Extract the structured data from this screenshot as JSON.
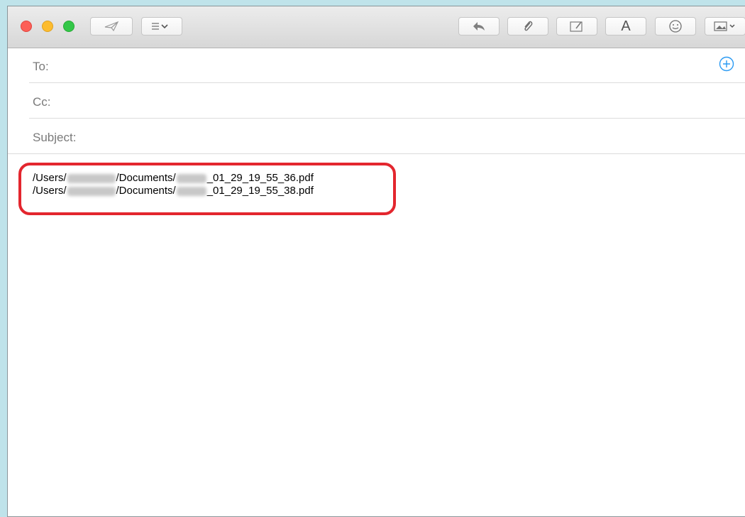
{
  "toolbar": {
    "buttons": [
      {
        "name": "send-button",
        "icon": "paper-plane-icon"
      },
      {
        "name": "header-fields-button",
        "icon": "list-chevron-icon"
      },
      {
        "name": "reply-button",
        "icon": "reply-arrow-icon"
      },
      {
        "name": "attach-button",
        "icon": "paperclip-icon"
      },
      {
        "name": "markup-button",
        "icon": "markup-icon"
      },
      {
        "name": "format-button",
        "icon": "letter-a-icon",
        "label": "A"
      },
      {
        "name": "emoji-button",
        "icon": "smiley-icon"
      },
      {
        "name": "photo-browser-button",
        "icon": "photo-icon"
      }
    ]
  },
  "fields": {
    "to_label": "To:",
    "cc_label": "Cc:",
    "subject_label": "Subject:"
  },
  "body": {
    "lines": [
      {
        "prefix": "/Users/",
        "middle": "/Documents/",
        "suffix": "_01_29_19_55_36.pdf"
      },
      {
        "prefix": "/Users/",
        "middle": "/Documents/",
        "suffix": "_01_29_19_55_38.pdf"
      }
    ]
  },
  "colors": {
    "highlight": "#e3262e",
    "accent": "#2a9af3",
    "background": "#bfe3ea"
  }
}
